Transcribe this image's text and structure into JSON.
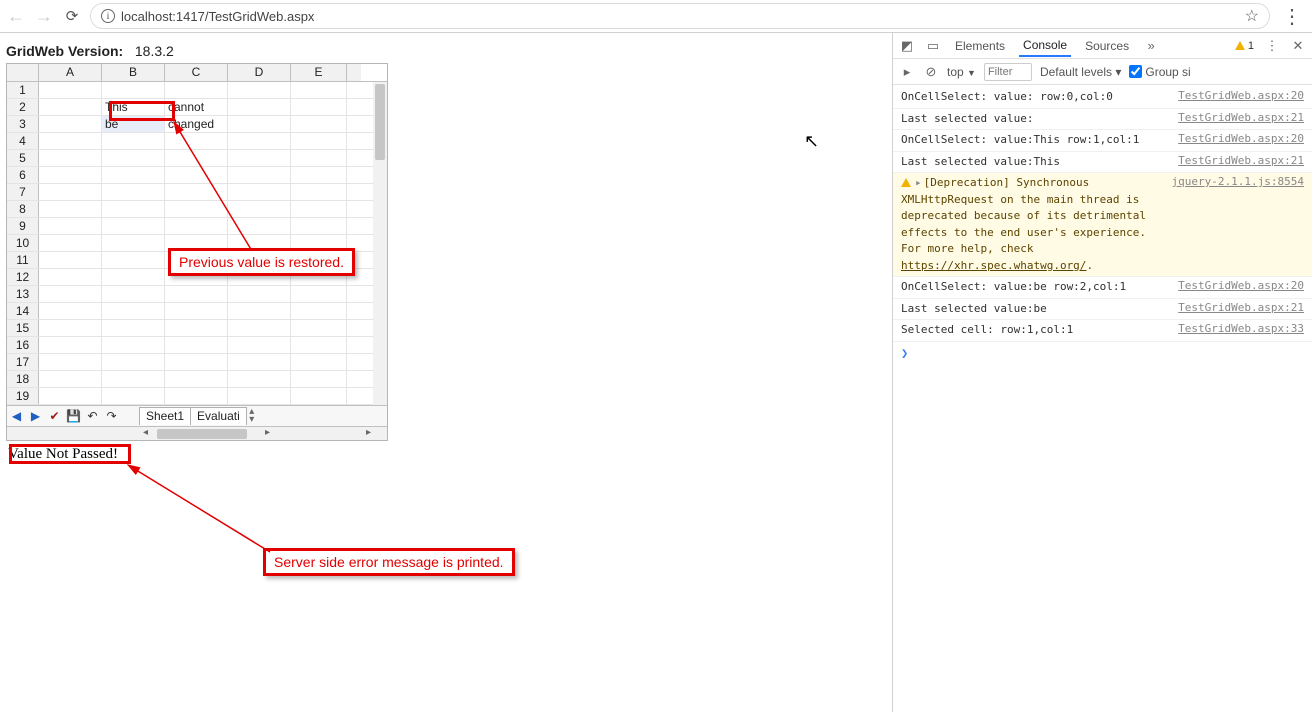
{
  "browser": {
    "url": "localhost:1417/TestGridWeb.aspx"
  },
  "page": {
    "version_label": "GridWeb Version:",
    "version_value": "18.3.2",
    "status_message": "Value Not Passed!"
  },
  "grid": {
    "columns": [
      "A",
      "B",
      "C",
      "D",
      "E"
    ],
    "row_numbers": [
      "1",
      "2",
      "3",
      "4",
      "5",
      "6",
      "7",
      "8",
      "9",
      "10",
      "11",
      "12",
      "13",
      "14",
      "15",
      "16",
      "17",
      "18",
      "19"
    ],
    "cells": {
      "B2": "This",
      "C2": "cannot",
      "B3": "be",
      "C3": "changed"
    },
    "tabs": [
      "Sheet1",
      "Evaluati"
    ]
  },
  "icons": {
    "back": "←",
    "forward": "→",
    "reload": "⟳",
    "info": "i",
    "star": "☆",
    "kebab": "⋮",
    "tab_prev": "◀",
    "tab_next": "▶",
    "check": "✔",
    "save": "💾",
    "undo": "↶",
    "redo": "↷",
    "inspect": "◩",
    "device": "▭",
    "stop": "⊘",
    "play": "▸",
    "chevron": "»",
    "close": "✕"
  },
  "callouts": {
    "restore": "Previous value is restored.",
    "server": "Server side error message is printed."
  },
  "devtools": {
    "tabs": [
      "Elements",
      "Console",
      "Sources"
    ],
    "more": "»",
    "warn_count": "1",
    "context": "top",
    "filter_placeholder": "Filter",
    "levels": "Default levels ▾",
    "group": "Group si",
    "logs": [
      {
        "msg": "OnCellSelect: value: row:0,col:0",
        "src": "TestGridWeb.aspx:20"
      },
      {
        "msg": "Last selected value:",
        "src": "TestGridWeb.aspx:21"
      },
      {
        "msg": "OnCellSelect: value:This row:1,col:1",
        "src": "TestGridWeb.aspx:20"
      },
      {
        "msg": "Last selected value:This",
        "src": "TestGridWeb.aspx:21"
      },
      {
        "warn": true,
        "msg": "[Deprecation] Synchronous XMLHttpRequest on the main thread is deprecated because of its detrimental effects to the end user's experience. For more help, check ",
        "link": "https://xhr.spec.whatwg.org/",
        "src": "jquery-2.1.1.js:8554"
      },
      {
        "msg": "OnCellSelect: value:be row:2,col:1",
        "src": "TestGridWeb.aspx:20"
      },
      {
        "msg": "Last selected value:be",
        "src": "TestGridWeb.aspx:21"
      },
      {
        "msg": "Selected cell: row:1,col:1",
        "src": "TestGridWeb.aspx:33"
      }
    ],
    "prompt": "❯"
  }
}
